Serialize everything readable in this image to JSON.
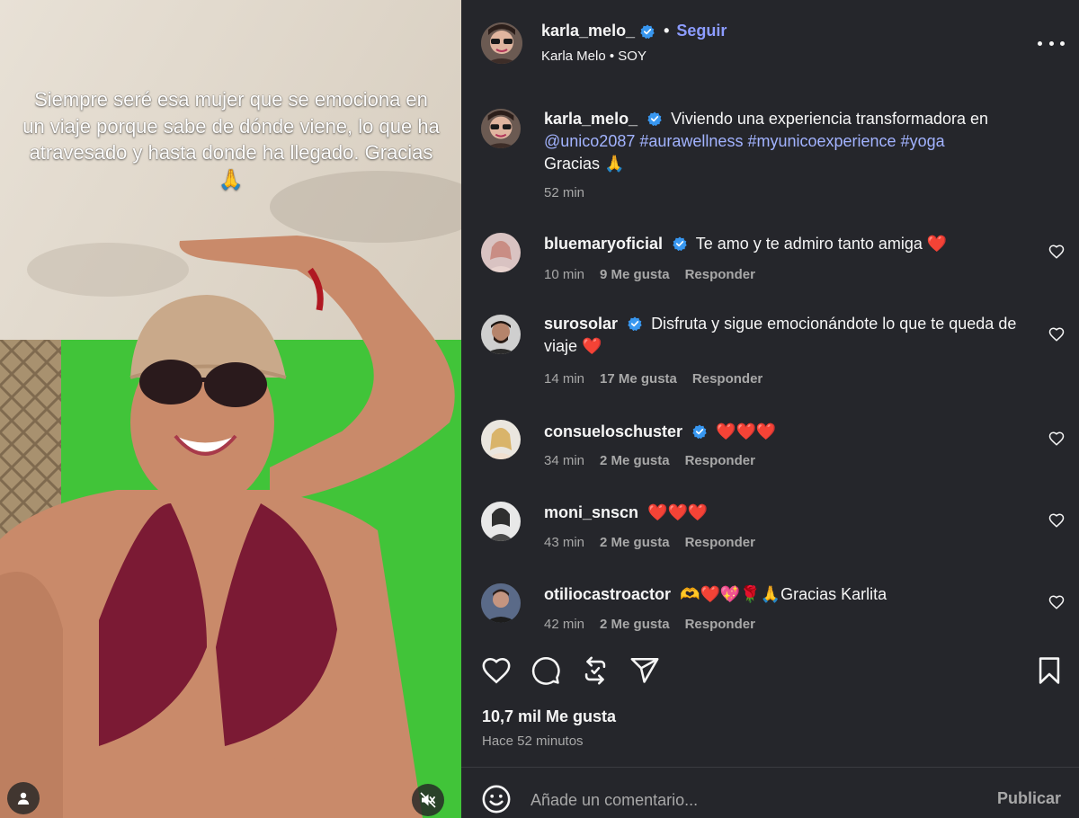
{
  "media": {
    "overlay_text": "Siempre seré esa mujer que se emociona en un viaje porque sabe de dónde viene, lo que ha atravesado y hasta donde ha llegado. Gracias 🙏",
    "user_icon": "person-icon",
    "mute_icon": "speaker-muted-icon"
  },
  "header": {
    "username": "karla_melo_",
    "verified": true,
    "separator": "•",
    "follow_label": "Seguir",
    "subtitle": "Karla Melo • SOY",
    "more_icon": "more-options-icon"
  },
  "caption": {
    "username": "karla_melo_",
    "text_before": "Viviendo una experiencia transformadora en ",
    "mentions": [
      "@unico2087",
      "#aurawellness",
      "#myunicoexperience",
      "#yoga"
    ],
    "text_after": "Gracias 🙏",
    "time": "52 min"
  },
  "comments": [
    {
      "username": "bluemaryoficial",
      "verified": true,
      "text": "Te amo y te admiro tanto amiga ❤️",
      "time": "10 min",
      "likes": "9 Me gusta",
      "reply": "Responder"
    },
    {
      "username": "surosolar",
      "verified": true,
      "text": "Disfruta y sigue emocionándote lo que te queda de viaje ❤️",
      "time": "14 min",
      "likes": "17 Me gusta",
      "reply": "Responder"
    },
    {
      "username": "consueloschuster",
      "verified": true,
      "text": "❤️❤️❤️",
      "time": "34 min",
      "likes": "2 Me gusta",
      "reply": "Responder"
    },
    {
      "username": "moni_snscn",
      "verified": false,
      "text": "❤️❤️❤️",
      "time": "43 min",
      "likes": "2 Me gusta",
      "reply": "Responder"
    },
    {
      "username": "otiliocastroactor",
      "verified": false,
      "text": "🫶❤️💖🌹🙏Gracias Karlita",
      "time": "42 min",
      "likes": "2 Me gusta",
      "reply": "Responder"
    }
  ],
  "actions": {
    "like_icon": "heart-icon",
    "comment_icon": "comment-icon",
    "repost_icon": "repost-icon",
    "share_icon": "share-icon",
    "save_icon": "bookmark-icon"
  },
  "stats": {
    "likes_total": "10,7 mil Me gusta",
    "posted": "Hace 52 minutos"
  },
  "compose": {
    "emoji_icon": "emoji-icon",
    "placeholder": "Añade un comentario...",
    "publish_label": "Publicar"
  },
  "colors": {
    "panel_bg": "#25262b",
    "link": "#a2b3ff",
    "follow": "#8c9cff",
    "verified": "#3897f0",
    "muted_text": "#a8a8a8",
    "heart": "#ff3040"
  }
}
